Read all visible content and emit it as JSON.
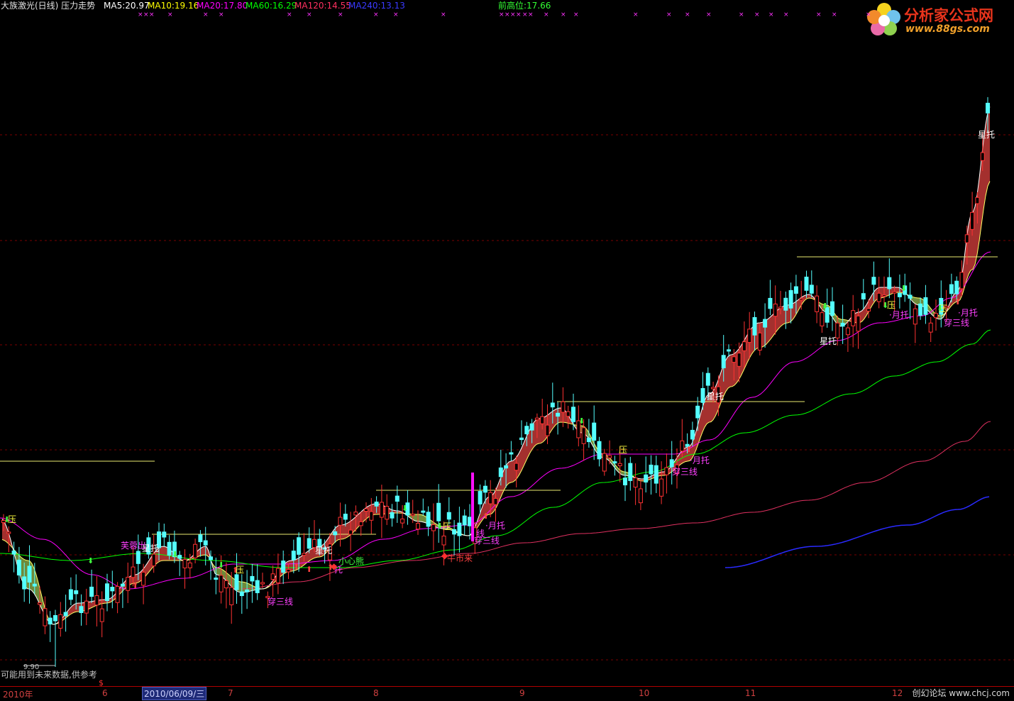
{
  "header": {
    "title": "大族激光(日线) 压力走势",
    "ma5": "MA5:20.97",
    "ma10": "MA10:19.16",
    "ma20": "MA20:17.80",
    "ma60": "MA60:16.29",
    "ma120": "MA120:14.55",
    "ma240": "MA240:13.13",
    "prev_high": "前高位:17.66"
  },
  "colors": {
    "ma5": "#ffffff",
    "ma10": "#ffff00",
    "ma20": "#ff00ff",
    "ma60": "#00ff00",
    "ma120": "#ff3060",
    "ma240": "#3030ff",
    "up": "#ff3232",
    "down": "#54ffff",
    "grid": "#7a0000",
    "prev_high": "#33ff33"
  },
  "logo": {
    "name": "分析家公式网",
    "url": "www.88gs.com"
  },
  "signals": {
    "ya": "压",
    "xingtuo": "星托",
    "yuetuo": "月托",
    "chuansanxian": "穿三线",
    "xiaoxinxiong": "小心熊",
    "niushilai": "牛市来",
    "furong": "芙蓉出",
    "sanxian_short": "线"
  },
  "warning": "可能用到未来数据,供参考",
  "low_label": "9.90",
  "xaxis": {
    "year": "2010年",
    "m6": "6",
    "selected": "2010/06/09/三",
    "m7": "7",
    "m8": "8",
    "m9": "9",
    "m10": "10",
    "m11": "11",
    "m12": "12",
    "dollar": "$"
  },
  "footer": "创幻论坛 www.chcj.com",
  "chart_data": {
    "type": "candlestick",
    "symbol": "大族激光",
    "period": "日线",
    "ma_values": {
      "MA5": 20.97,
      "MA10": 19.16,
      "MA20": 17.8,
      "MA60": 16.29,
      "MA120": 14.55,
      "MA240": 13.13
    },
    "prev_high": 17.66,
    "low_marker": 9.9,
    "months": [
      "2010年",
      "6",
      "7",
      "8",
      "9",
      "10",
      "11",
      "12"
    ]
  }
}
